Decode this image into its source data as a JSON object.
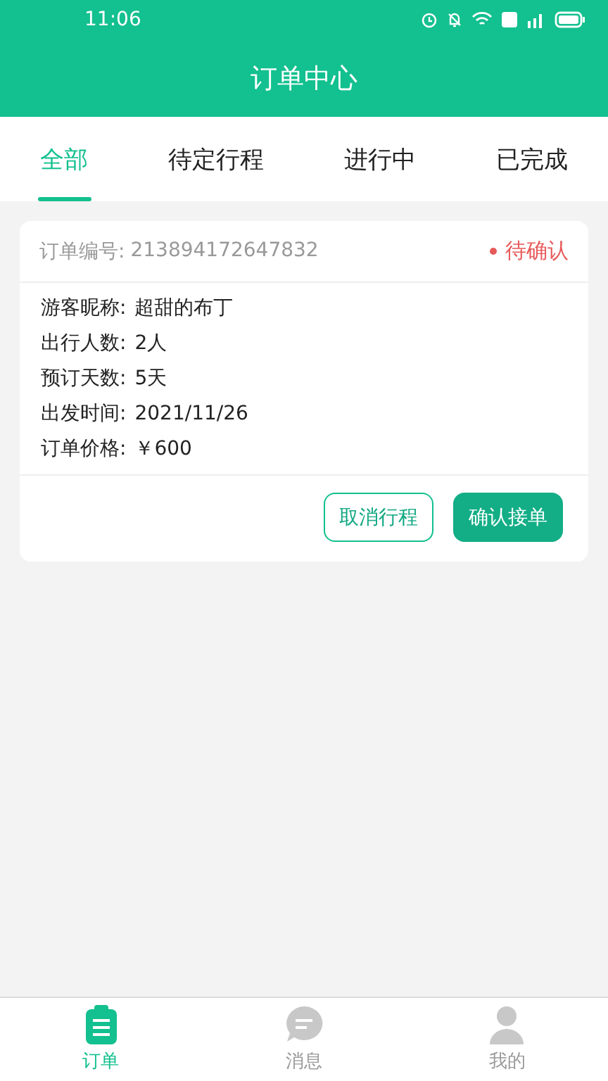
{
  "status_bar": {
    "time": "11:06"
  },
  "header": {
    "title": "订单中心"
  },
  "tabs": [
    {
      "label": "全部",
      "selected": true
    },
    {
      "label": "待定行程",
      "selected": false
    },
    {
      "label": "进行中",
      "selected": false
    },
    {
      "label": "已完成",
      "selected": false
    }
  ],
  "orders": [
    {
      "number_label": "订单编号:",
      "number": "213894172647832",
      "status": "待确认",
      "color": "#e85a5a",
      "fields": [
        {
          "label": "游客昵称:",
          "value": "超甜的布丁"
        },
        {
          "label": "出行人数:",
          "value": "2人"
        },
        {
          "label": "预订天数:",
          "value": "5天"
        },
        {
          "label": "出发时间:",
          "value": "2021/11/26"
        },
        {
          "label": "订单价格:",
          "value": "￥600"
        }
      ],
      "buttons": [
        {
          "label": "取消行程",
          "kind": "outline"
        },
        {
          "label": "确认接单",
          "kind": "primary"
        }
      ]
    }
  ],
  "bottom_nav": [
    {
      "label": "订单",
      "kind": "orders",
      "selected": true
    },
    {
      "label": "消息",
      "kind": "messages",
      "selected": false
    },
    {
      "label": "我的",
      "kind": "profile",
      "selected": false
    }
  ]
}
